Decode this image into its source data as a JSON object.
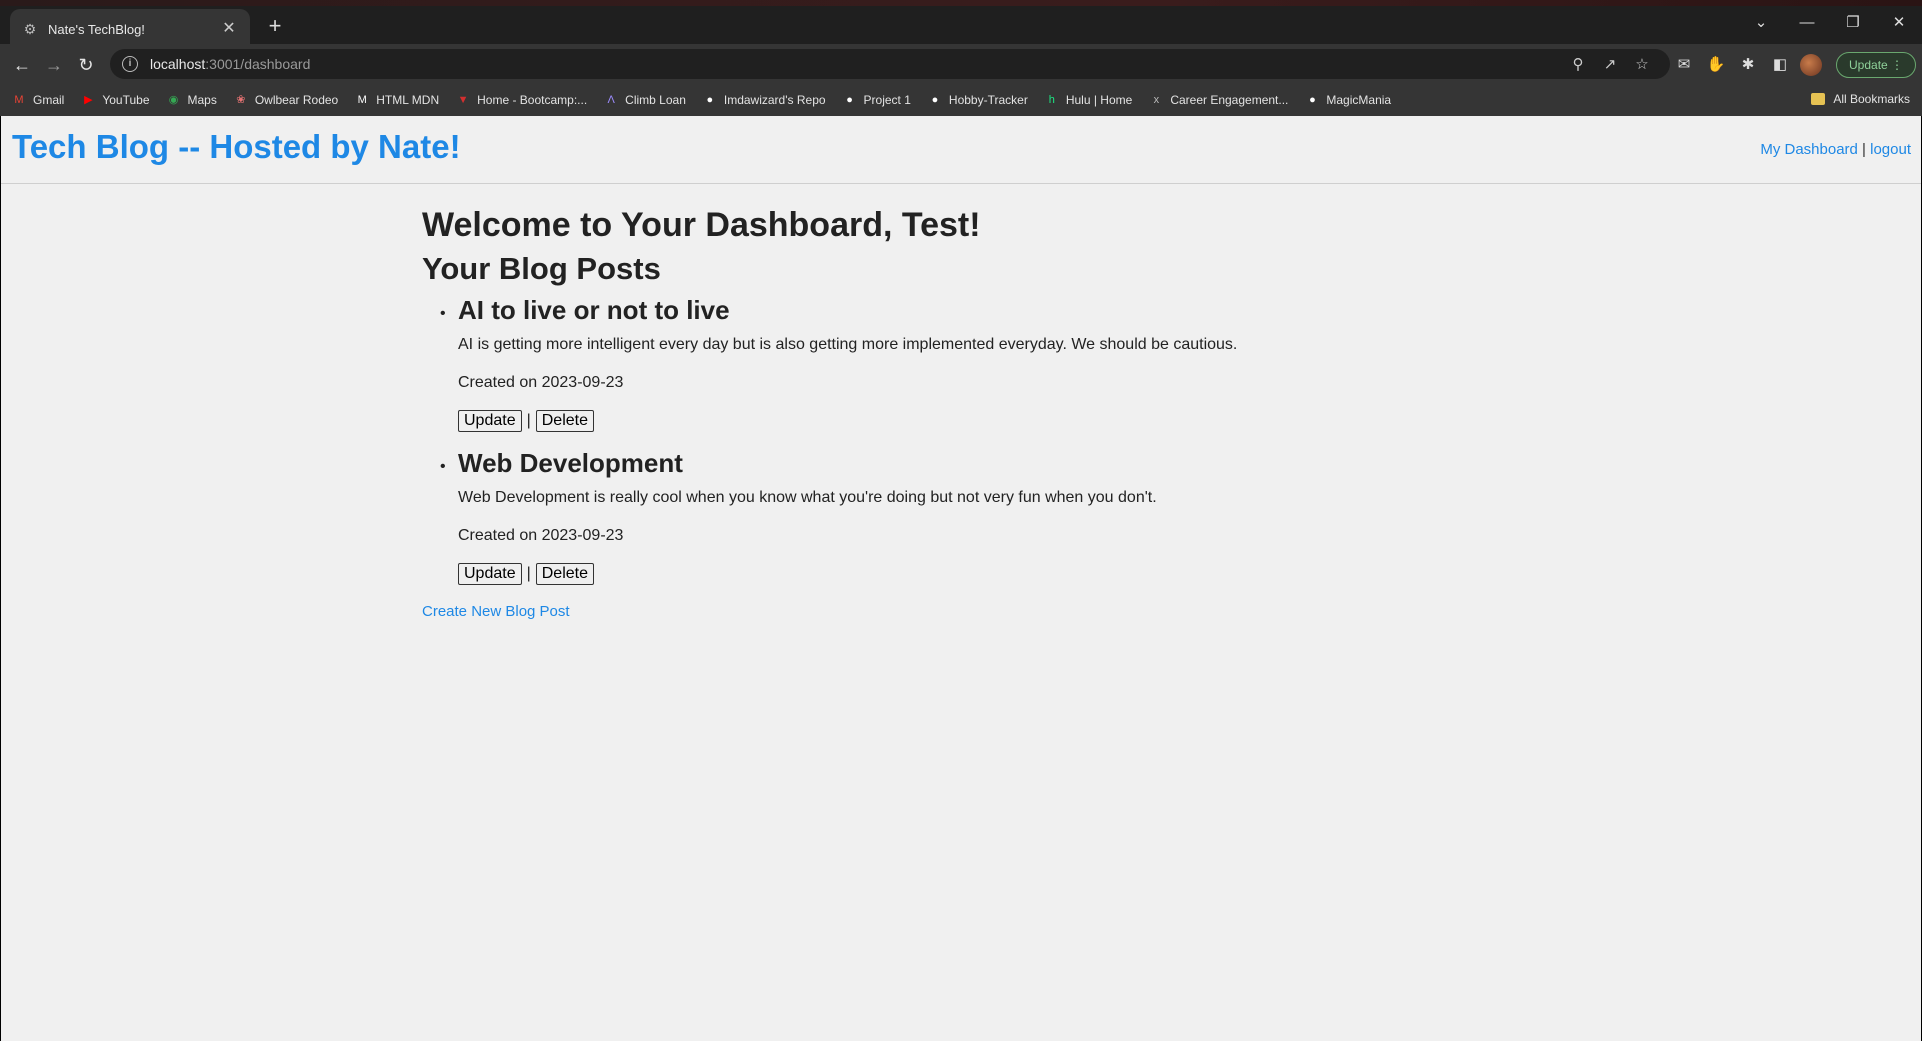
{
  "browser": {
    "tab_title": "Nate's TechBlog!",
    "url_host": "localhost",
    "url_rest": ":3001/dashboard",
    "update_label": "Update",
    "bookmarks": [
      {
        "label": "Gmail",
        "icon": "gmail-icon",
        "color": "#ea4335"
      },
      {
        "label": "YouTube",
        "icon": "youtube-icon",
        "color": "#ff0000"
      },
      {
        "label": "Maps",
        "icon": "maps-icon",
        "color": "#34a853"
      },
      {
        "label": "Owlbear Rodeo",
        "icon": "owlbear-icon",
        "color": "#e57373"
      },
      {
        "label": "HTML MDN",
        "icon": "mdn-icon",
        "color": "#ffffff"
      },
      {
        "label": "Home - Bootcamp:...",
        "icon": "bootcamp-icon",
        "color": "#d32f2f"
      },
      {
        "label": "Climb Loan",
        "icon": "climb-icon",
        "color": "#9c8cff"
      },
      {
        "label": "Imdawizard's Repo",
        "icon": "github-icon",
        "color": "#ffffff"
      },
      {
        "label": "Project 1",
        "icon": "github-icon",
        "color": "#ffffff"
      },
      {
        "label": "Hobby-Tracker",
        "icon": "github-icon",
        "color": "#ffffff"
      },
      {
        "label": "Hulu | Home",
        "icon": "hulu-icon",
        "color": "#1ce783"
      },
      {
        "label": "Career Engagement...",
        "icon": "edx-icon",
        "color": "#bbbbbb"
      },
      {
        "label": "MagicMania",
        "icon": "github-icon",
        "color": "#ffffff"
      }
    ],
    "all_bookmarks_label": "All Bookmarks"
  },
  "site": {
    "title": "Tech Blog -- Hosted by Nate!",
    "nav_dashboard": "My Dashboard",
    "nav_separator": "|",
    "nav_logout": "logout"
  },
  "dashboard": {
    "welcome": "Welcome to Your Dashboard, Test!",
    "posts_heading": "Your Blog Posts",
    "posts": [
      {
        "title": "AI to live or not to live",
        "body": "AI is getting more intelligent every day but is also getting more implemented everyday. We should be cautious.",
        "date": "Created on 2023-09-23",
        "update_label": "Update",
        "separator": "|",
        "delete_label": "Delete"
      },
      {
        "title": "Web Development",
        "body": "Web Development is really cool when you know what you're doing but not very fun when you don't.",
        "date": "Created on 2023-09-23",
        "update_label": "Update",
        "separator": "|",
        "delete_label": "Delete"
      }
    ],
    "create_link": "Create New Blog Post"
  }
}
